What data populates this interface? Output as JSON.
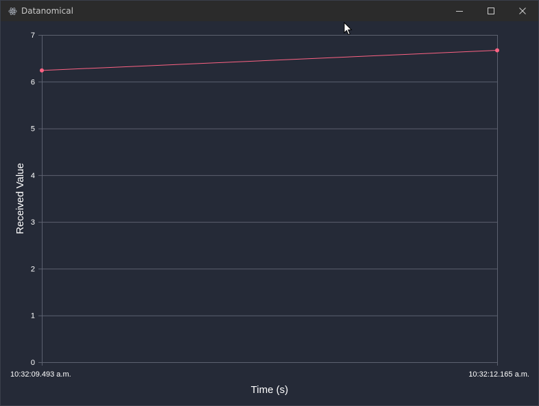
{
  "window": {
    "title": "Datanomical",
    "app_icon": "atom-icon",
    "controls": [
      "minimize-icon",
      "maximize-icon",
      "close-icon"
    ]
  },
  "colors": {
    "background": "#252a37",
    "grid": "#5d6270",
    "series": "#ff6384",
    "text": "#ffffff"
  },
  "chart_data": {
    "type": "line",
    "title": "",
    "xlabel": "Time (s)",
    "ylabel": "Received Value",
    "x": [
      "10:32:09.493 a.m.",
      "10:32:12.165 a.m."
    ],
    "series": [
      {
        "values": [
          6.24,
          6.67
        ]
      }
    ],
    "ylim": [
      0,
      7
    ],
    "yticks": [
      0,
      1,
      2,
      3,
      4,
      5,
      6,
      7
    ],
    "grid": true,
    "legend": "none"
  }
}
